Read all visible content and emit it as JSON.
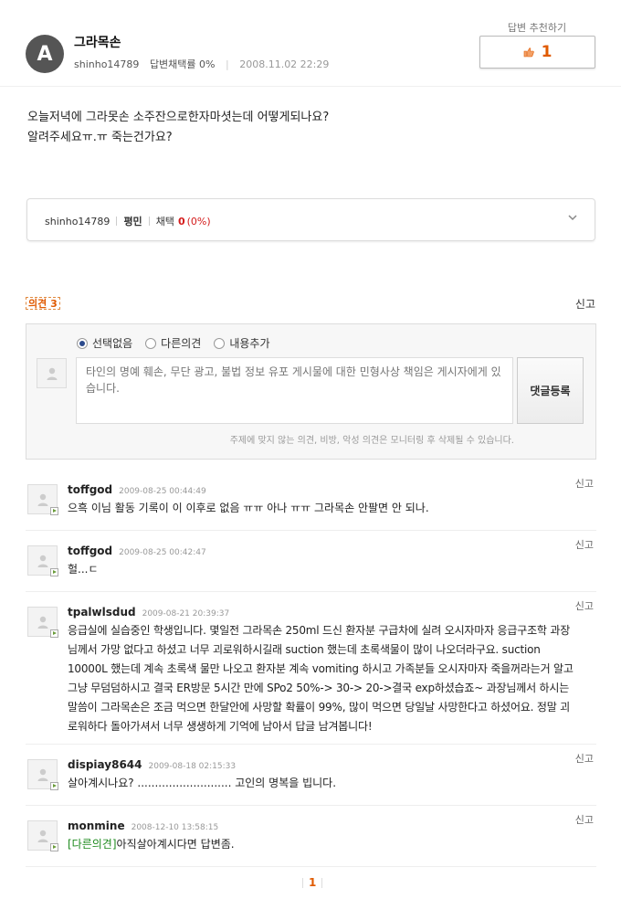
{
  "header": {
    "avatar_letter": "A",
    "title": "그라목손",
    "author": "shinho14789",
    "adopt_rate": "답변채택률 0%",
    "date": "2008.11.02 22:29",
    "recommend_label": "답변 추천하기",
    "recommend_count": "1"
  },
  "question": {
    "line1": "오늘저녁에 그라못손 소주잔으로한자마셧는데 어떻게되나요?",
    "line2": "알려주세요ㅠ.ㅠ 죽는건가요?"
  },
  "author_box": {
    "username": "shinho14789",
    "rank": "평민",
    "adopt_label": "채택",
    "adopt_count": "0",
    "adopt_pct": "(0%)"
  },
  "opinion_section": {
    "title": "의견 3",
    "report": "신고",
    "options": [
      "선택없음",
      "다른의견",
      "내용추가"
    ],
    "selected": "선택없음",
    "placeholder": "타인의 명예 훼손, 무단 광고, 불법 정보 유포 게시물에 대한 민형사상 책임은 게시자에게 있습니다.",
    "submit_label": "댓글등록",
    "notice": "주제에 맞지 않는 의견, 비방, 악성 의견은 모니터링 후 삭제될 수 있습니다."
  },
  "comments": [
    {
      "name": "toffgod",
      "date": "2009-08-25 00:44:49",
      "report": "신고",
      "text": "으흑 이님 활동 기록이 이 이후로 없음 ㅠㅠ 아나 ㅠㅠ 그라목손 안팔면 안 되나."
    },
    {
      "name": "toffgod",
      "date": "2009-08-25 00:42:47",
      "report": "신고",
      "text": "헐...ㄷ"
    },
    {
      "name": "tpalwlsdud",
      "date": "2009-08-21 20:39:37",
      "report": "신고",
      "text": "응급실에 실습중인 학생입니다. 몇일전 그라목손 250ml 드신 환자분 구급차에 실려 오시자마자 응급구조학 과장님께서 가망 없다고 하셨고 너무 괴로워하시길래 suction 했는데 초록색물이 많이 나오더라구요. suction 10000L 했는데 계속 초록색 물만 나오고 환자분 계속 vomiting 하시고 가족분들 오시자마자 죽을꺼라는거 알고 그냥 무덤덤하시고 결국 ER방문 5시간 만에 SPo2 50%-> 30-> 20->결국 exp하셨습죠~ 과장님께서 하시는 말씀이 그라목손은 조금 먹으면 한달안에 사망할 확률이 99%, 많이 먹으면 당일날 사망한다고 하셨어요. 정말 괴로워하다 돌아가셔서 너무 생생하게 기억에 남아서 답글 남겨봅니다!"
    },
    {
      "name": "dispiay8644",
      "date": "2009-08-18 02:15:33",
      "report": "신고",
      "text": "살아계시나요? ........................... 고인의 명복을 빕니다."
    },
    {
      "name": "monmine",
      "date": "2008-12-10 13:58:15",
      "report": "신고",
      "tag": "[다른의견]",
      "text": "아직살아계시다면 답변좀."
    }
  ],
  "pager": {
    "current": "1"
  },
  "colors": {
    "accent": "#e05a00",
    "alert": "#d41c1c",
    "tag": "#1d8a1d"
  }
}
